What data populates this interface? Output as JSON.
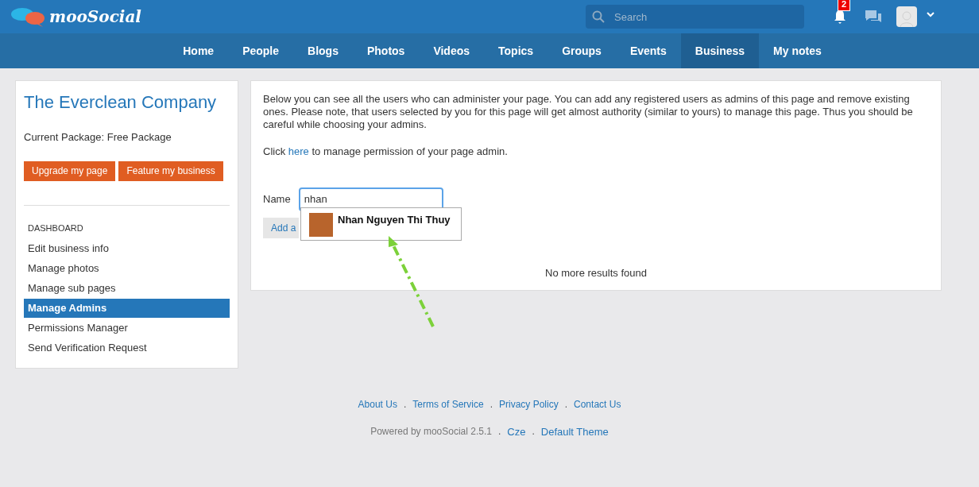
{
  "header": {
    "logo": "mooSocial",
    "search": {
      "placeholder": "Search"
    },
    "notifications": {
      "count": "2"
    }
  },
  "nav": [
    {
      "label": "Home",
      "selected": false
    },
    {
      "label": "People",
      "selected": false
    },
    {
      "label": "Blogs",
      "selected": false
    },
    {
      "label": "Photos",
      "selected": false
    },
    {
      "label": "Videos",
      "selected": false
    },
    {
      "label": "Topics",
      "selected": false
    },
    {
      "label": "Groups",
      "selected": false
    },
    {
      "label": "Events",
      "selected": false
    },
    {
      "label": "Business",
      "selected": true
    },
    {
      "label": "My notes",
      "selected": false
    }
  ],
  "sidebar": {
    "title": "The Everclean Company",
    "package": "Current Package: Free Package",
    "buttons": [
      "Upgrade my page",
      "Feature my business"
    ],
    "section": "DASHBOARD",
    "items": [
      {
        "label": "Edit business info",
        "selected": false
      },
      {
        "label": "Manage photos",
        "selected": false
      },
      {
        "label": "Manage sub pages",
        "selected": false
      },
      {
        "label": "Manage Admins",
        "selected": true
      },
      {
        "label": "Permissions Manager",
        "selected": false
      },
      {
        "label": "Send Verification Request",
        "selected": false
      }
    ]
  },
  "main": {
    "description": "Below you can see all the users who can administer your page. You can add any registered users as admins of this page and remove existing ones. Please note, that users selected by you for this page will get almost authority (similar to yours) to manage this page. Thus you should be careful while choosing your admins.",
    "permission": {
      "before": "Click",
      "link": "here",
      "after": "to manage permission of your page admin."
    },
    "name_label": "Name",
    "name_value": "nhan",
    "add_button": "Add a",
    "suggestion": "Nhan Nguyen Thi Thuy",
    "no_more": "No more results found"
  },
  "footer": {
    "separator": ".",
    "links": [
      "About Us",
      "Terms of Service",
      "Privacy Policy",
      "Contact Us"
    ],
    "powered": "Powered by mooSocial 2.5.1",
    "extra_links": [
      "Cze",
      "Default Theme"
    ]
  }
}
